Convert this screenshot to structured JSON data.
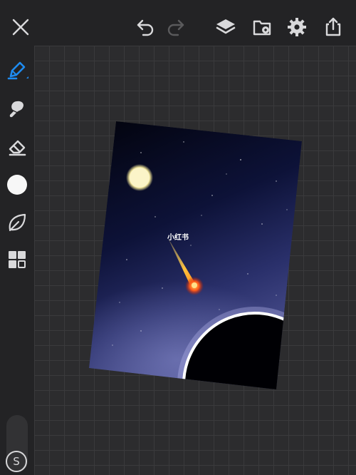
{
  "toolbar": {
    "close": "close-icon",
    "undo": "undo-icon",
    "redo": "redo-icon",
    "layers": "layers-icon",
    "import": "import-icon",
    "settings": "gear-icon",
    "share": "share-icon"
  },
  "tools": [
    "pen-icon",
    "smudge-icon",
    "eraser-icon",
    "color-swatch",
    "leaf-icon",
    "grid-icon"
  ],
  "artwork": {
    "watermark": "小红书"
  },
  "size_button": {
    "label": "S"
  },
  "colors": {
    "accent": "#1e8bf0",
    "toolbar_bg": "#232325",
    "icon": "#d9d9db"
  }
}
